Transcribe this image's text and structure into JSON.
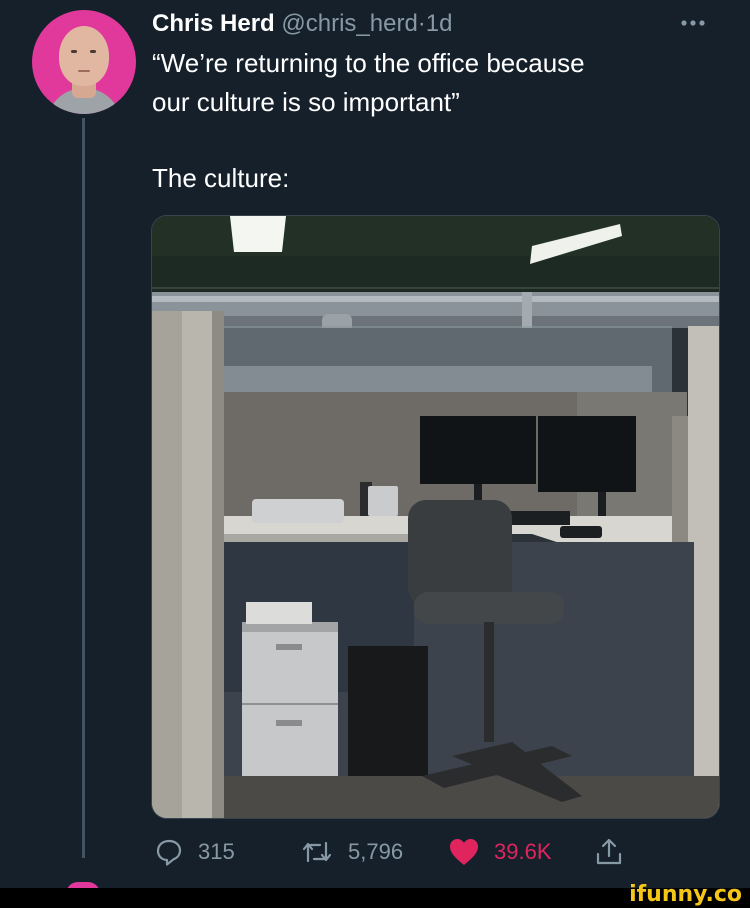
{
  "tweet": {
    "author_name": "Chris Herd",
    "handle": "@chris_herd",
    "separator": "·",
    "time": "1d",
    "more_icon": "ellipsis-icon",
    "lines": [
      "“We’re returning to the office because",
      "our culture is so important”",
      "The culture:"
    ],
    "photo_alt": "office-cubicle-photo"
  },
  "actions": {
    "replies": "315",
    "retweets": "5,796",
    "likes": "39.6K",
    "like_color": "#e0245e",
    "icons": [
      "reply-icon",
      "retweet-icon",
      "heart-icon",
      "share-icon"
    ]
  },
  "watermark": {
    "text": "ifunny.co",
    "color": "#f5c518"
  },
  "theme": {
    "background": "#15202b",
    "secondary_text": "#8899a6",
    "avatar_bg": "#e0399b"
  }
}
